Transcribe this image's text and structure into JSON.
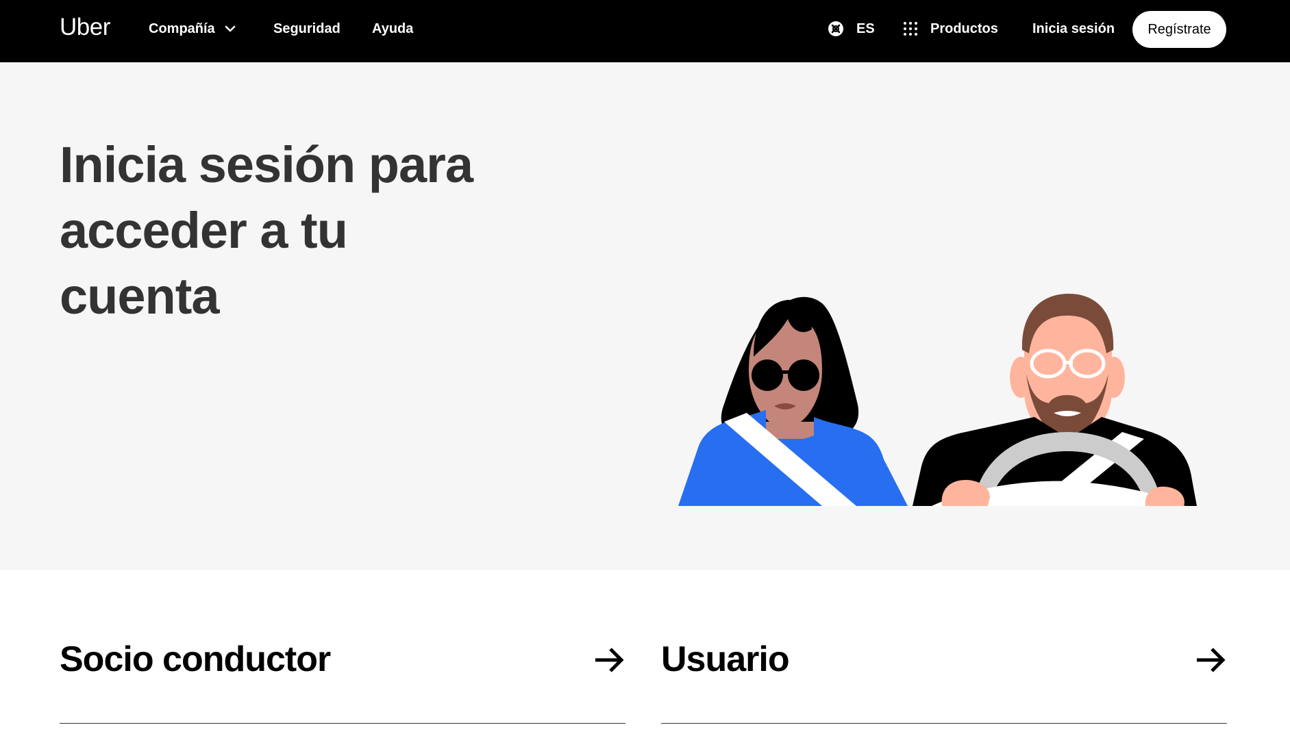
{
  "nav": {
    "logo": "Uber",
    "company": "Compañía",
    "security": "Seguridad",
    "help": "Ayuda",
    "language": "ES",
    "products": "Productos",
    "login": "Inicia sesión",
    "signup": "Regístrate"
  },
  "hero": {
    "title": "Inicia sesión para acceder a tu cuenta"
  },
  "options": [
    {
      "label": "Socio conductor",
      "icon": "arrow-right-icon"
    },
    {
      "label": "Usuario",
      "icon": "arrow-right-icon"
    }
  ],
  "colors": {
    "nav_bg": "#000000",
    "hero_bg": "#f6f6f6",
    "accent_blue": "#276ef1",
    "text_dark": "#333333"
  }
}
